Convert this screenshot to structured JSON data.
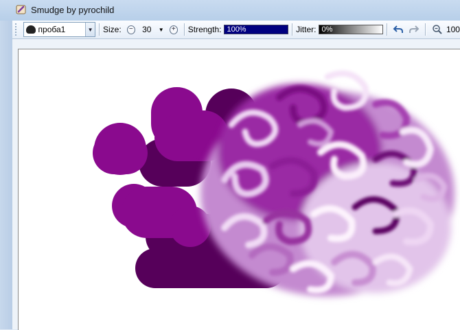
{
  "window": {
    "title": "Smudge by pyrochild"
  },
  "toolbar": {
    "brush_name": "проба1",
    "size_label": "Size:",
    "size_value": "30",
    "strength_label": "Strength:",
    "strength_value": "100%",
    "strength_level": 1.0,
    "jitter_label": "Jitter:",
    "jitter_value": "0%",
    "jitter_level": 0.0,
    "zoom_value": "100"
  },
  "colors": {
    "dark_purple": "#56005a",
    "mid_purple": "#8a0a8e",
    "light_purple": "#d8a8e0",
    "strength_fill": "#000080"
  }
}
